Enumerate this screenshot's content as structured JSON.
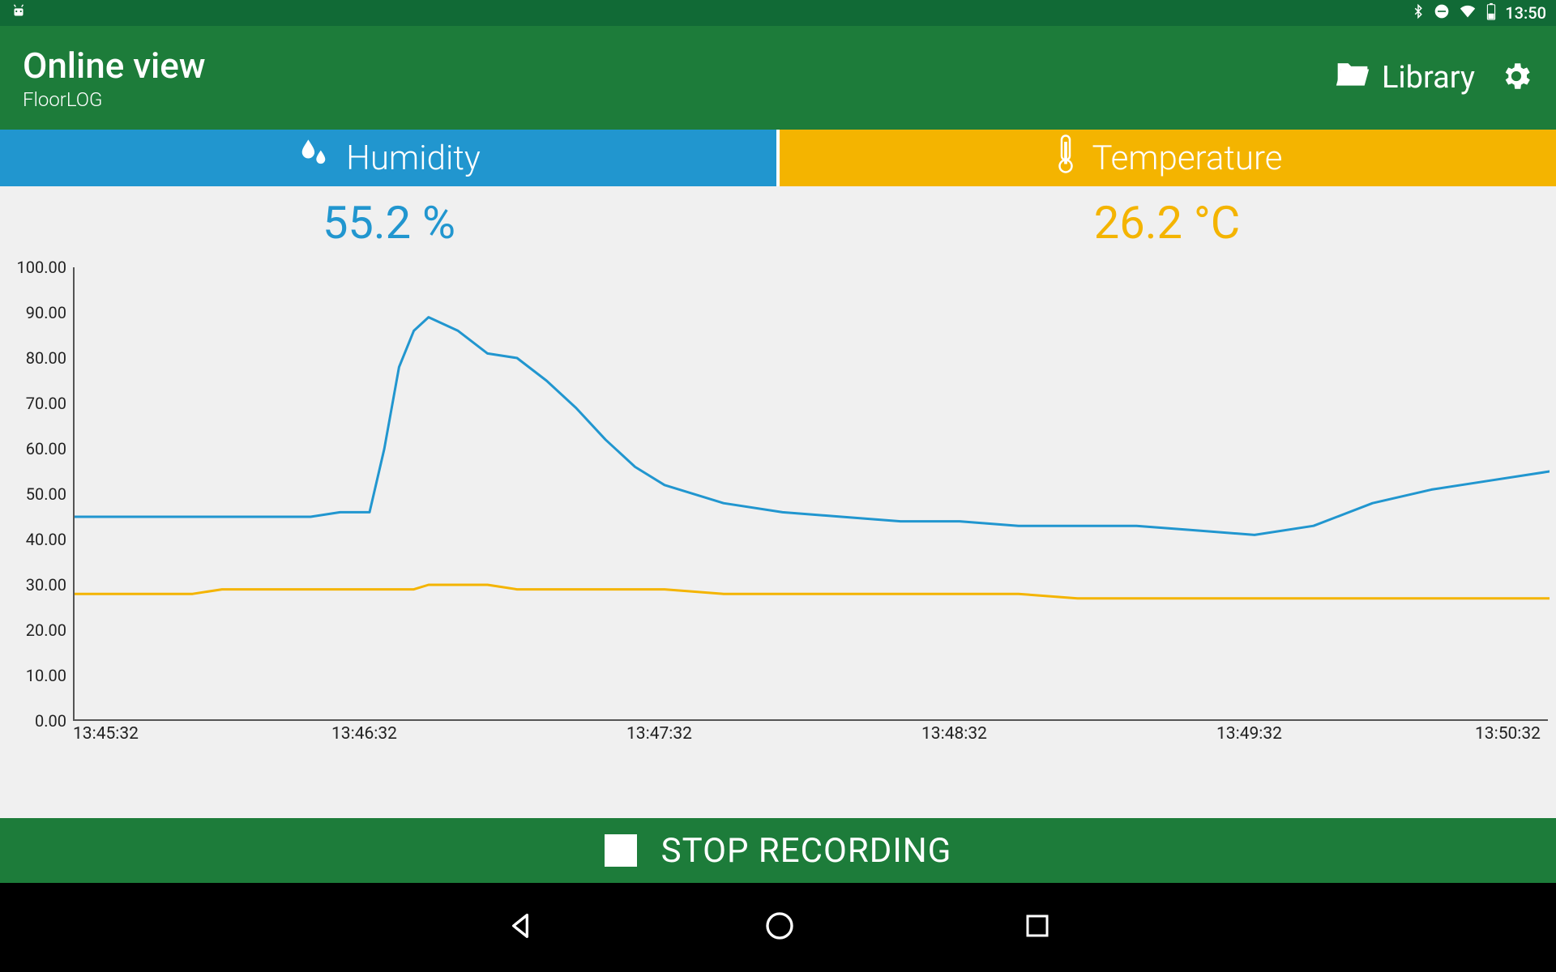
{
  "status_bar": {
    "time": "13:50"
  },
  "app_bar": {
    "title": "Online view",
    "subtitle": "FloorLOG",
    "library_label": "Library"
  },
  "tabs": {
    "humidity_label": "Humidity",
    "temperature_label": "Temperature"
  },
  "readings": {
    "humidity_value": "55.2 %",
    "temperature_value": "26.2 °C"
  },
  "bottom_button": {
    "label": "STOP RECORDING"
  },
  "colors": {
    "brand_green": "#1d7c3a",
    "status_green": "#116a36",
    "humidity_blue": "#2196cf",
    "temperature_yellow": "#f4b400"
  },
  "chart_data": {
    "type": "line",
    "xlabel": "",
    "ylabel": "",
    "ylim": [
      0,
      100
    ],
    "x_ticks": [
      "13:45:32",
      "13:46:32",
      "13:47:32",
      "13:48:32",
      "13:49:32",
      "13:50:32"
    ],
    "y_ticks": [
      "0.00",
      "10.00",
      "20.00",
      "30.00",
      "40.00",
      "50.00",
      "60.00",
      "70.00",
      "80.00",
      "90.00",
      "100.00"
    ],
    "x": [
      0.0,
      0.1,
      0.2,
      0.3,
      0.4,
      0.5,
      0.6,
      0.7,
      0.8,
      0.9,
      1.0,
      1.05,
      1.1,
      1.15,
      1.2,
      1.3,
      1.4,
      1.5,
      1.6,
      1.7,
      1.8,
      1.9,
      2.0,
      2.2,
      2.4,
      2.6,
      2.8,
      3.0,
      3.2,
      3.4,
      3.6,
      3.8,
      4.0,
      4.2,
      4.4,
      4.6,
      4.8,
      5.0
    ],
    "series": [
      {
        "name": "Humidity",
        "color": "#2196cf",
        "values": [
          45,
          45,
          45,
          45,
          45,
          45,
          45,
          45,
          45,
          46,
          46,
          60,
          78,
          86,
          89,
          86,
          81,
          80,
          75,
          69,
          62,
          56,
          52,
          48,
          46,
          45,
          44,
          44,
          43,
          43,
          43,
          42,
          41,
          43,
          48,
          51,
          53,
          55
        ]
      },
      {
        "name": "Temperature",
        "color": "#f4b400",
        "values": [
          28,
          28,
          28,
          28,
          28,
          29,
          29,
          29,
          29,
          29,
          29,
          29,
          29,
          29,
          30,
          30,
          30,
          29,
          29,
          29,
          29,
          29,
          29,
          28,
          28,
          28,
          28,
          28,
          28,
          27,
          27,
          27,
          27,
          27,
          27,
          27,
          27,
          27
        ]
      }
    ]
  }
}
